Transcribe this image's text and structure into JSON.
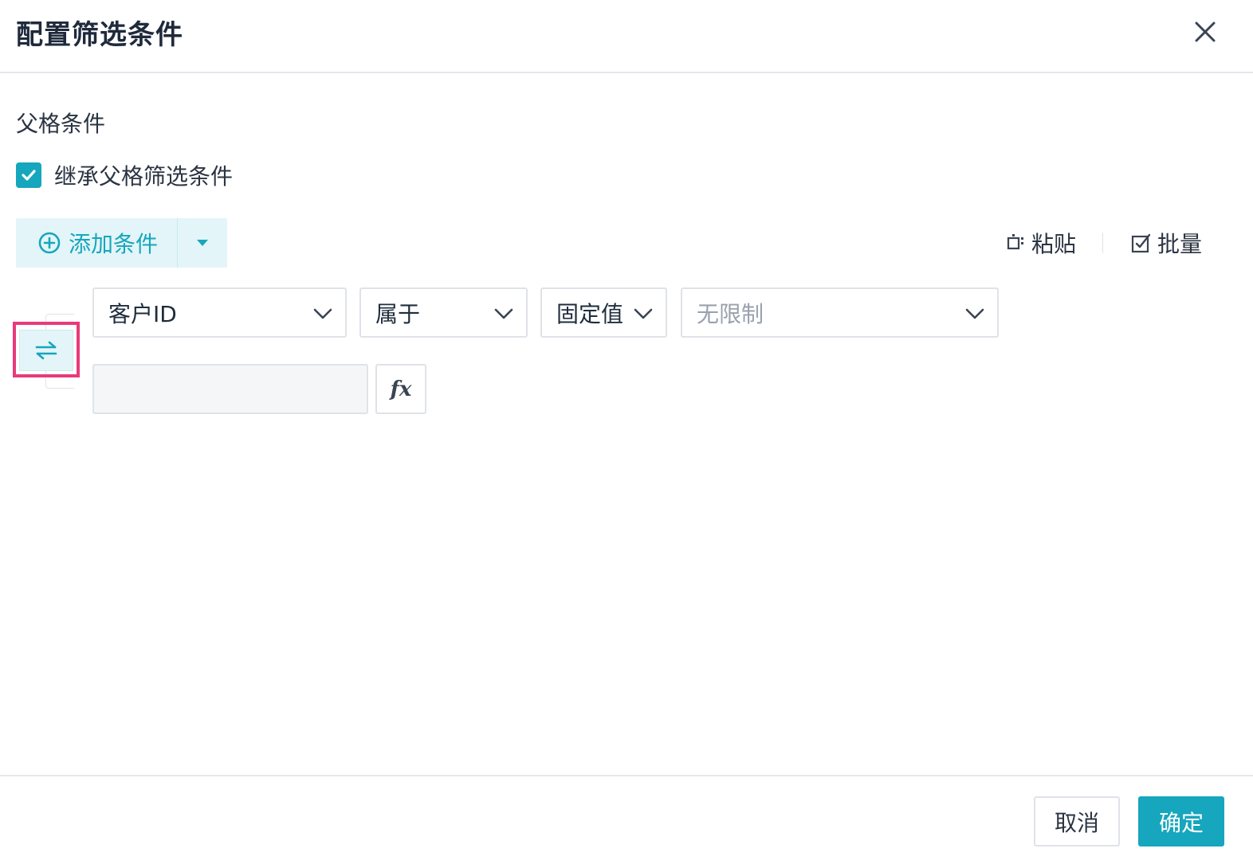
{
  "dialog": {
    "title": "配置筛选条件"
  },
  "parent_section": {
    "label": "父格条件",
    "inherit_checkbox": {
      "label": "继承父格筛选条件",
      "checked": true
    }
  },
  "toolbar": {
    "add_condition_label": "添加条件",
    "paste_label": "粘贴",
    "batch_label": "批量"
  },
  "condition": {
    "field": "客户ID",
    "operator": "属于",
    "value_type": "固定值",
    "value_select_placeholder": "无限制",
    "value_input": "",
    "fx_label": "fx"
  },
  "footer": {
    "cancel_label": "取消",
    "confirm_label": "确定"
  },
  "colors": {
    "accent": "#16a6bd",
    "accent_light": "#e3f5f8",
    "highlight": "#e93a7a",
    "border": "#dfe3e8"
  }
}
